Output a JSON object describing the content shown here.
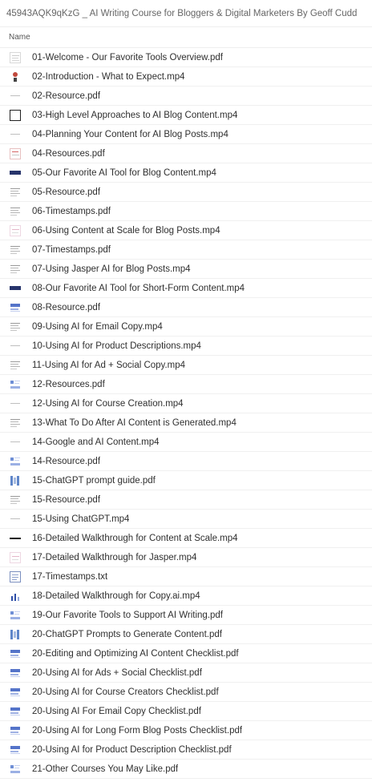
{
  "window": {
    "title": "45943AQK9qKzG _ AI Writing Course for Bloggers & Digital Marketers By Geoff Cudd"
  },
  "table": {
    "column_name": "Name"
  },
  "files": [
    {
      "name": "01-Welcome - Our Favorite Tools Overview.pdf",
      "icon": "th-doc"
    },
    {
      "name": "02-Introduction - What to Expect.mp4",
      "icon": "th-dot"
    },
    {
      "name": "02-Resource.pdf",
      "icon": "th-blank"
    },
    {
      "name": "03-High Level Approaches to AI Blog Content.mp4",
      "icon": "th-frame"
    },
    {
      "name": "04-Planning Your Content for AI Blog Posts.mp4",
      "icon": "th-blank"
    },
    {
      "name": "04-Resources.pdf",
      "icon": "th-red"
    },
    {
      "name": "05-Our Favorite AI Tool for Blog Content.mp4",
      "icon": "th-bar"
    },
    {
      "name": "05-Resource.pdf",
      "icon": "th-lines"
    },
    {
      "name": "06-Timestamps.pdf",
      "icon": "th-lines"
    },
    {
      "name": "06-Using Content at Scale for Blog Posts.mp4",
      "icon": "th-pink"
    },
    {
      "name": "07-Timestamps.pdf",
      "icon": "th-lines"
    },
    {
      "name": "07-Using Jasper AI for Blog Posts.mp4",
      "icon": "th-lines"
    },
    {
      "name": "08-Our Favorite AI Tool for Short-Form Content.mp4",
      "icon": "th-bar"
    },
    {
      "name": "08-Resource.pdf",
      "icon": "th-blue"
    },
    {
      "name": "09-Using AI for Email Copy.mp4",
      "icon": "th-lines"
    },
    {
      "name": "10-Using AI for Product Descriptions.mp4",
      "icon": "th-blank"
    },
    {
      "name": "11-Using AI for Ad + Social Copy.mp4",
      "icon": "th-lines"
    },
    {
      "name": "12-Resources.pdf",
      "icon": "th-blue2"
    },
    {
      "name": "12-Using AI for Course Creation.mp4",
      "icon": "th-blank"
    },
    {
      "name": "13-What To Do After AI Content is Generated.mp4",
      "icon": "th-lines"
    },
    {
      "name": "14-Google and AI Content.mp4",
      "icon": "th-blank"
    },
    {
      "name": "14-Resource.pdf",
      "icon": "th-blue2"
    },
    {
      "name": "15-ChatGPT prompt guide.pdf",
      "icon": "th-gpt"
    },
    {
      "name": "15-Resource.pdf",
      "icon": "th-lines"
    },
    {
      "name": "15-Using ChatGPT.mp4",
      "icon": "th-blank"
    },
    {
      "name": "16-Detailed Walkthrough for Content at Scale.mp4",
      "icon": "th-dash"
    },
    {
      "name": "17-Detailed Walkthrough for Jasper.mp4",
      "icon": "th-pink"
    },
    {
      "name": "17-Timestamps.txt",
      "icon": "th-txt"
    },
    {
      "name": "18-Detailed Walkthrough for Copy.ai.mp4",
      "icon": "th-chart"
    },
    {
      "name": "19-Our Favorite Tools to Support AI Writing.pdf",
      "icon": "th-blue2"
    },
    {
      "name": "20-ChatGPT Prompts to Generate Content.pdf",
      "icon": "th-gpt"
    },
    {
      "name": "20-Editing and Optimizing AI Content Checklist.pdf",
      "icon": "th-blue"
    },
    {
      "name": "20-Using AI for Ads + Social Checklist.pdf",
      "icon": "th-blue"
    },
    {
      "name": "20-Using AI for Course Creators Checklist.pdf",
      "icon": "th-blue"
    },
    {
      "name": "20-Using AI For Email Copy Checklist.pdf",
      "icon": "th-blue"
    },
    {
      "name": "20-Using AI for Long Form Blog Posts Checklist.pdf",
      "icon": "th-blue"
    },
    {
      "name": "20-Using AI for Product Description Checklist.pdf",
      "icon": "th-blue"
    },
    {
      "name": "21-Other Courses You May Like.pdf",
      "icon": "th-blue2"
    }
  ]
}
